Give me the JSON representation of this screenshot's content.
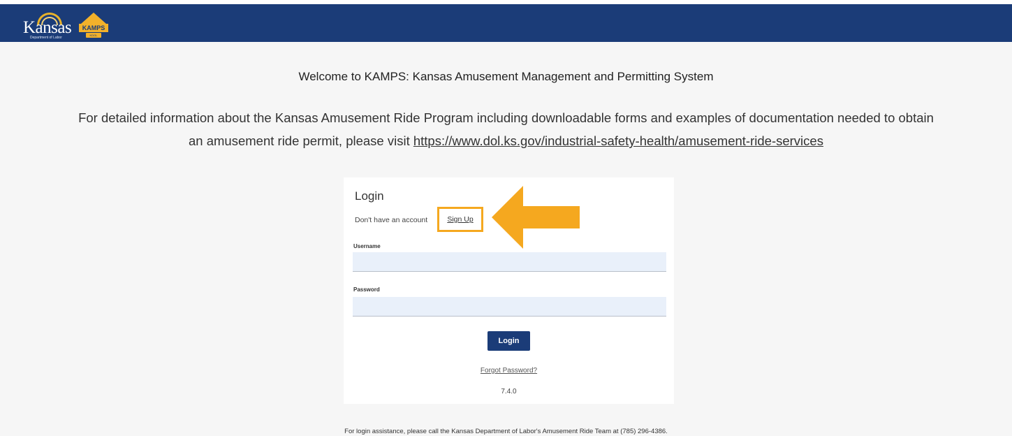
{
  "header": {
    "logo_kansas": "Kansas",
    "logo_kansas_sub": "Department of Labor",
    "logo_kamps": "KAMPS",
    "logo_kamps_sub": "KDOL",
    "bar_color": "#1b3c78"
  },
  "main": {
    "welcome": "Welcome to KAMPS: Kansas Amusement Management and Permitting System",
    "info_line1": "For detailed information about the Kansas Amusement Ride Program including downloadable forms and examples of documentation needed to obtain",
    "info_line2_prefix": "an amusement ride permit, please visit ",
    "info_link": "https://www.dol.ks.gov/industrial-safety-health/amusement-ride-services"
  },
  "login": {
    "title": "Login",
    "no_account_text": "Don't have an account",
    "signup_label": "Sign Up",
    "username_label": "Username",
    "username_value": "",
    "password_label": "Password",
    "password_value": "",
    "login_button": "Login",
    "forgot_password": "Forgot Password?",
    "version": "7.4.0"
  },
  "annotation": {
    "highlight_color": "#f5a81f",
    "arrow_icon": "arrow-left-icon"
  },
  "footer": {
    "assistance": "For login assistance, please call the Kansas Department of Labor's Amusement Ride Team at (785) 296-4386."
  }
}
